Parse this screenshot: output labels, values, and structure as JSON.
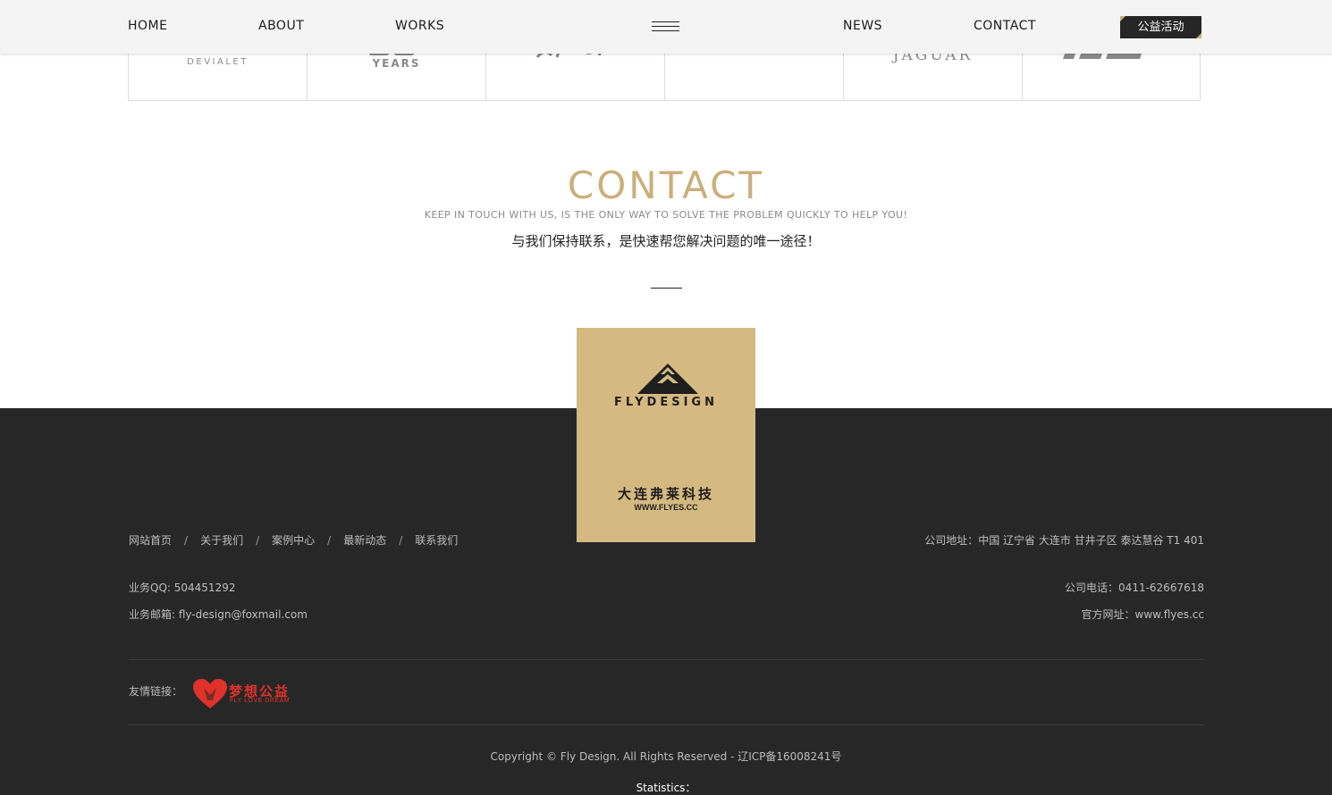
{
  "nav": {
    "home": "HOME",
    "about": "ABOUT",
    "works": "WORKS",
    "news": "NEWS",
    "contact": "CONTACT",
    "special_button": "公益活动"
  },
  "brands": [
    {
      "text": "DEVIALET"
    },
    {
      "text": "YEARS"
    },
    {
      "text": ""
    },
    {
      "text": ""
    },
    {
      "text": "JAGUAR"
    },
    {
      "text": ""
    }
  ],
  "contact": {
    "title": "CONTACT",
    "subtitle_en": "KEEP IN TOUCH WITH US, IS THE ONLY WAY TO SOLVE THE PROBLEM QUICKLY TO HELP YOU!",
    "subtitle_cn": "与我们保持联系，是快速帮您解决问题的唯一途径！"
  },
  "logo": {
    "name": "FLYDESIGN",
    "cn": "大连弗莱科技",
    "url": "WWW.FLYES.CC"
  },
  "footer": {
    "links": [
      "网站首页",
      "关于我们",
      "案例中心",
      "最新动态",
      "联系我们"
    ],
    "separator": "/",
    "address": "公司地址：中国 辽宁省 大连市 甘井子区 泰达慧谷 T1 401",
    "qq": "业务QQ: 504451292",
    "phone": "公司电话：0411-62667618",
    "email": "业务邮箱: fly-design@foxmail.com",
    "website": "官方网址：www.flyes.cc",
    "friend_label": "友情链接：",
    "friend_logo_cn": "梦想公益",
    "friend_logo_en": "FLY LOVE DREAM",
    "copyright": "Copyright © Fly Design. All Rights Reserved - 辽ICP备16008241号",
    "statistics": "Statistics："
  },
  "colors": {
    "gold": "#c9b07a",
    "logo_bg": "#d4b981",
    "footer_bg": "#272727",
    "friend_red": "#e0312b"
  }
}
